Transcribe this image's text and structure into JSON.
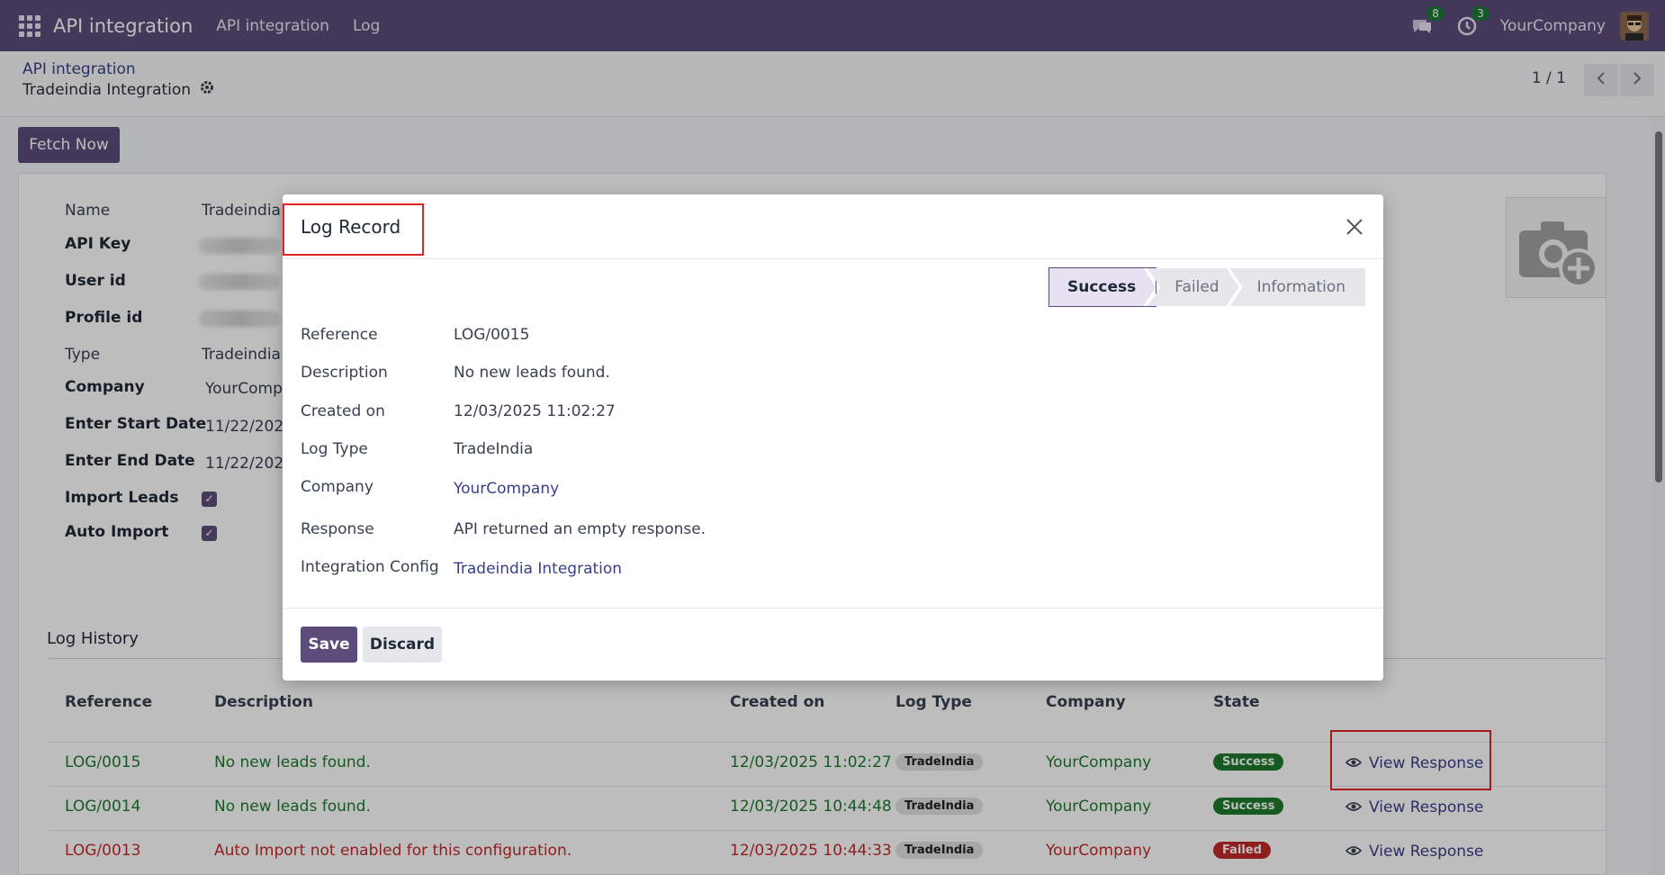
{
  "navbar": {
    "app_title": "API integration",
    "menu": [
      "API integration",
      "Log"
    ],
    "messages_count": "8",
    "activities_count": "3",
    "company": "YourCompany"
  },
  "breadcrumb": {
    "parent": "API integration",
    "current": "Tradeindia Integration"
  },
  "pager": {
    "value": "1 / 1"
  },
  "actions": {
    "fetch_now": "Fetch Now"
  },
  "form": {
    "name_label": "Name",
    "name_value": "Tradeindia",
    "api_key_label": "API Key",
    "user_id_label": "User id",
    "profile_id_label": "Profile id",
    "type_label": "Type",
    "type_value": "Tradeindia",
    "company_label": "Company",
    "company_value": "YourCompa",
    "start_date_label": "Enter Start Date",
    "start_date_value": "11/22/202",
    "end_date_label": "Enter End Date",
    "end_date_value": "11/22/202",
    "import_leads_label": "Import Leads",
    "auto_import_label": "Auto Import",
    "log_history_label": "Log History"
  },
  "log_table": {
    "headers": [
      "Reference",
      "Description",
      "Created on",
      "Log Type",
      "Company",
      "State"
    ],
    "rows": [
      {
        "reference": "LOG/0015",
        "description": "No new leads found.",
        "created_on": "12/03/2025 11:02:27",
        "log_type": "TradeIndia",
        "company": "YourCompany",
        "state": "Success",
        "action": "View Response"
      },
      {
        "reference": "LOG/0014",
        "description": "No new leads found.",
        "created_on": "12/03/2025 10:44:48",
        "log_type": "TradeIndia",
        "company": "YourCompany",
        "state": "Success",
        "action": "View Response"
      },
      {
        "reference": "LOG/0013",
        "description": "Auto Import not enabled for this configuration.",
        "created_on": "12/03/2025 10:44:33",
        "log_type": "TradeIndia",
        "company": "YourCompany",
        "state": "Failed",
        "action": "View Response"
      }
    ]
  },
  "modal": {
    "title": "Log Record",
    "stages": [
      "Success",
      "Failed",
      "Information"
    ],
    "active_stage": "Success",
    "fields": {
      "reference_label": "Reference",
      "reference_value": "LOG/0015",
      "description_label": "Description",
      "description_value": "No new leads found.",
      "created_on_label": "Created on",
      "created_on_value": "12/03/2025 11:02:27",
      "log_type_label": "Log Type",
      "log_type_value": "TradeIndia",
      "company_label": "Company",
      "company_value": "YourCompany",
      "response_label": "Response",
      "response_value": "API returned an empty response.",
      "integration_label": "Integration Config",
      "integration_value": "Tradeindia Integration"
    },
    "save_label": "Save",
    "discard_label": "Discard"
  },
  "colors": {
    "brand": "#5c4c7b",
    "success": "#1e7a2e",
    "failed": "#c22b2b",
    "highlight_box": "#e02424"
  },
  "icons": [
    "apps-grid-icon",
    "chat-icon",
    "clock-icon",
    "gear-icon",
    "chevron-left-icon",
    "chevron-right-icon",
    "camera-add-icon",
    "eye-icon",
    "close-icon",
    "checkbox-icon"
  ]
}
